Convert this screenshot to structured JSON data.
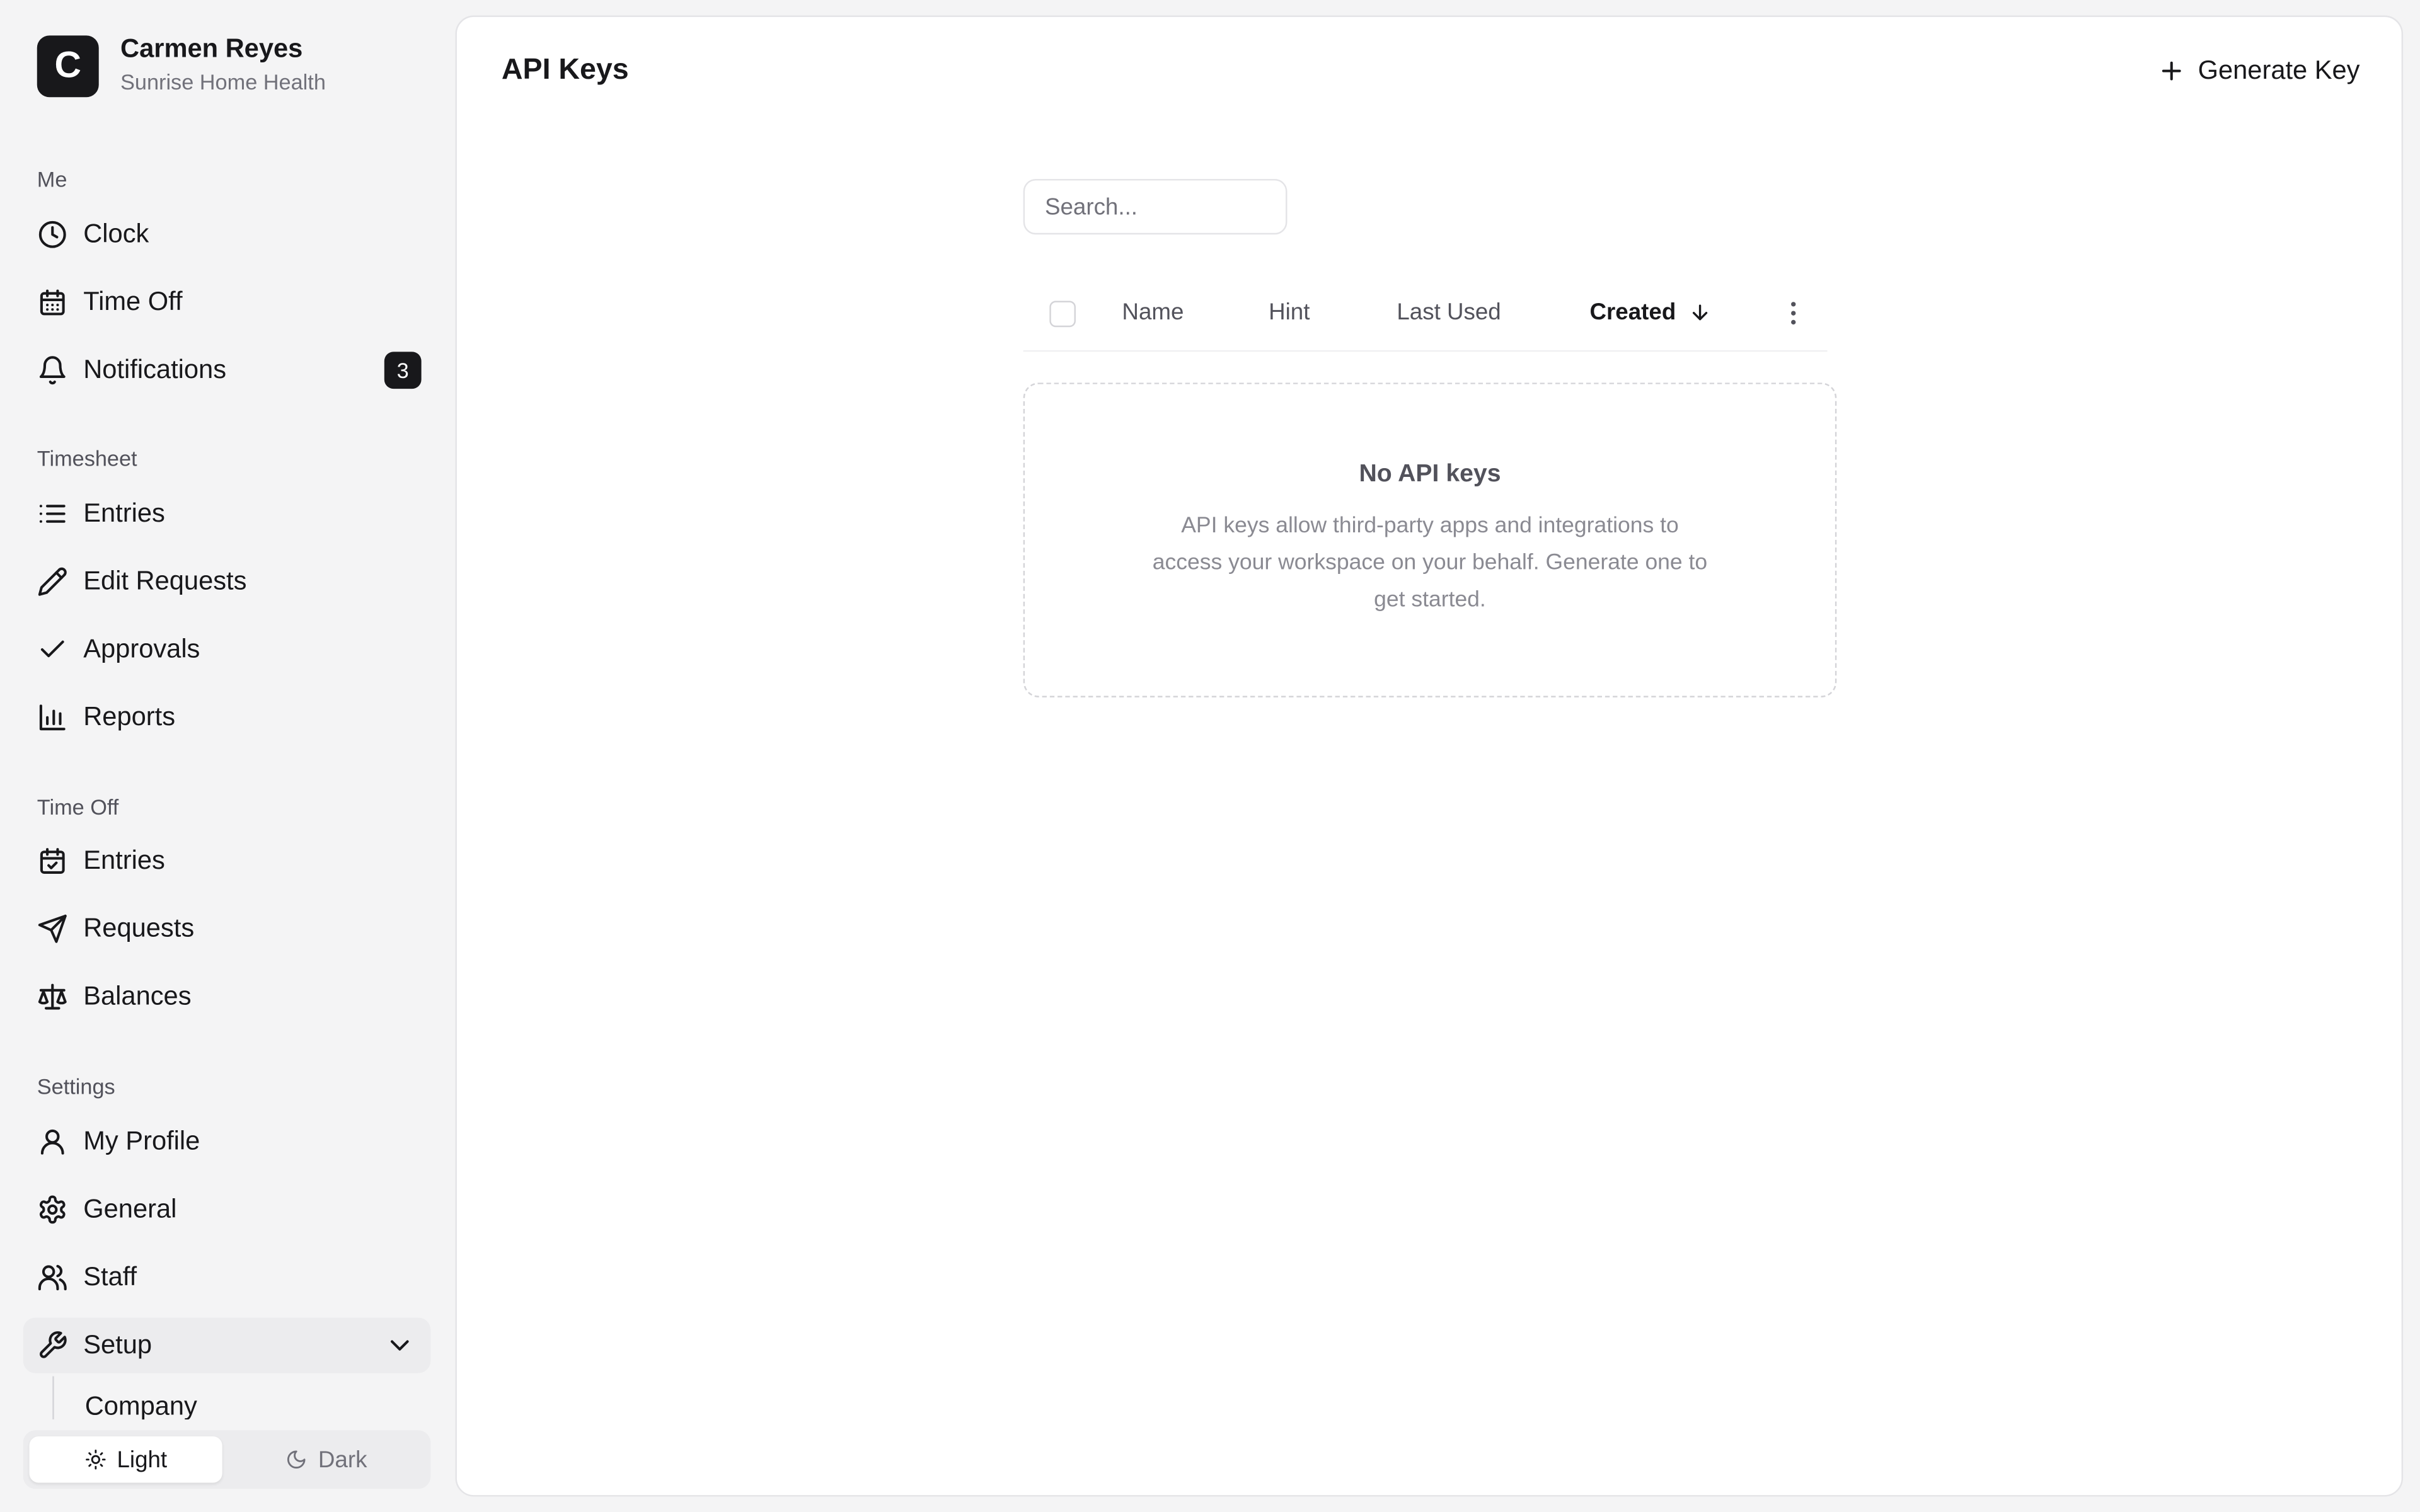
{
  "user": {
    "initial": "C",
    "name": "Carmen Reyes",
    "org": "Sunrise Home Health"
  },
  "sections": {
    "me": "Me",
    "timesheet": "Timesheet",
    "time_off": "Time Off",
    "settings": "Settings"
  },
  "nav": {
    "clock": "Clock",
    "time_off": "Time Off",
    "notifications": "Notifications",
    "notifications_count": "3",
    "ts_entries": "Entries",
    "edit_requests": "Edit Requests",
    "approvals": "Approvals",
    "reports": "Reports",
    "to_entries": "Entries",
    "requests": "Requests",
    "balances": "Balances",
    "my_profile": "My Profile",
    "general": "General",
    "staff": "Staff",
    "setup": "Setup",
    "company": "Company"
  },
  "theme": {
    "light": "Light",
    "dark": "Dark",
    "selected": "Light"
  },
  "page": {
    "title": "API Keys",
    "generate_label": "Generate Key",
    "search_placeholder": "Search...",
    "columns": {
      "name": "Name",
      "hint": "Hint",
      "last_used": "Last Used",
      "created": "Created"
    },
    "empty_title": "No API keys",
    "empty_desc": "API keys allow third-party apps and integrations to access your workspace on your behalf. Generate one to get started."
  },
  "colors": {
    "accent": "#18181b",
    "background": "#f4f4f5",
    "panel": "#ffffff",
    "active_item": "#ececee"
  }
}
